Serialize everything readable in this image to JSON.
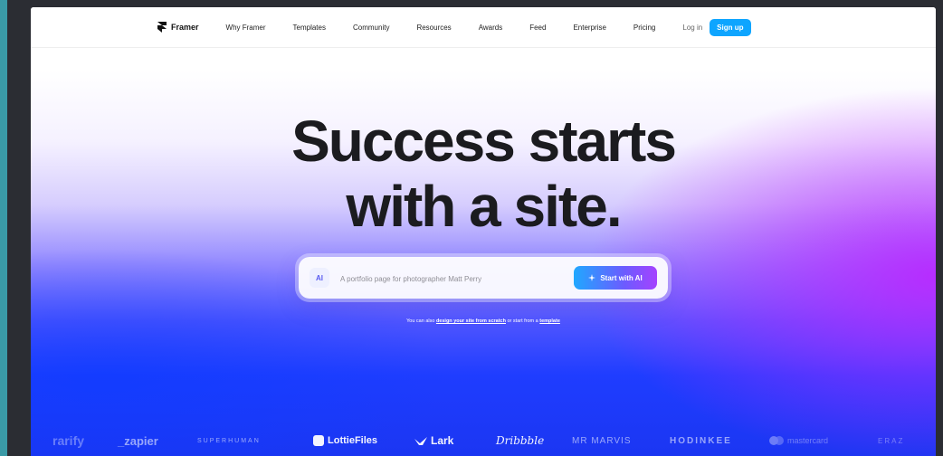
{
  "nav": {
    "brand": "Framer",
    "links": [
      "Why Framer",
      "Templates",
      "Community",
      "Resources",
      "Awards",
      "Feed",
      "Enterprise",
      "Pricing"
    ],
    "login": "Log in",
    "signup": "Sign up"
  },
  "hero": {
    "line1": "Success starts",
    "line2": "with a site."
  },
  "prompt": {
    "ai_badge": "AI",
    "placeholder": "A portfolio page for photographer Matt Perry",
    "button_label": "Start with AI",
    "button_icon": "sparkle-icon"
  },
  "subtext": {
    "prefix": "You can also",
    "link1": "design your site from scratch",
    "middle": "or start from a",
    "link2": "template"
  },
  "logos": [
    "rarify",
    "_zapier",
    "SUPERHUMAN",
    "LottieFiles",
    "Lark",
    "Dribbble",
    "MR MARVIS",
    "HODINKEE",
    "mastercard",
    "ERAZ"
  ],
  "colors": {
    "accent": "#0ea5ff",
    "ai_button_start": "#20a8ff",
    "ai_button_end": "#a542ff",
    "hero_text": "#1b1b1f"
  }
}
